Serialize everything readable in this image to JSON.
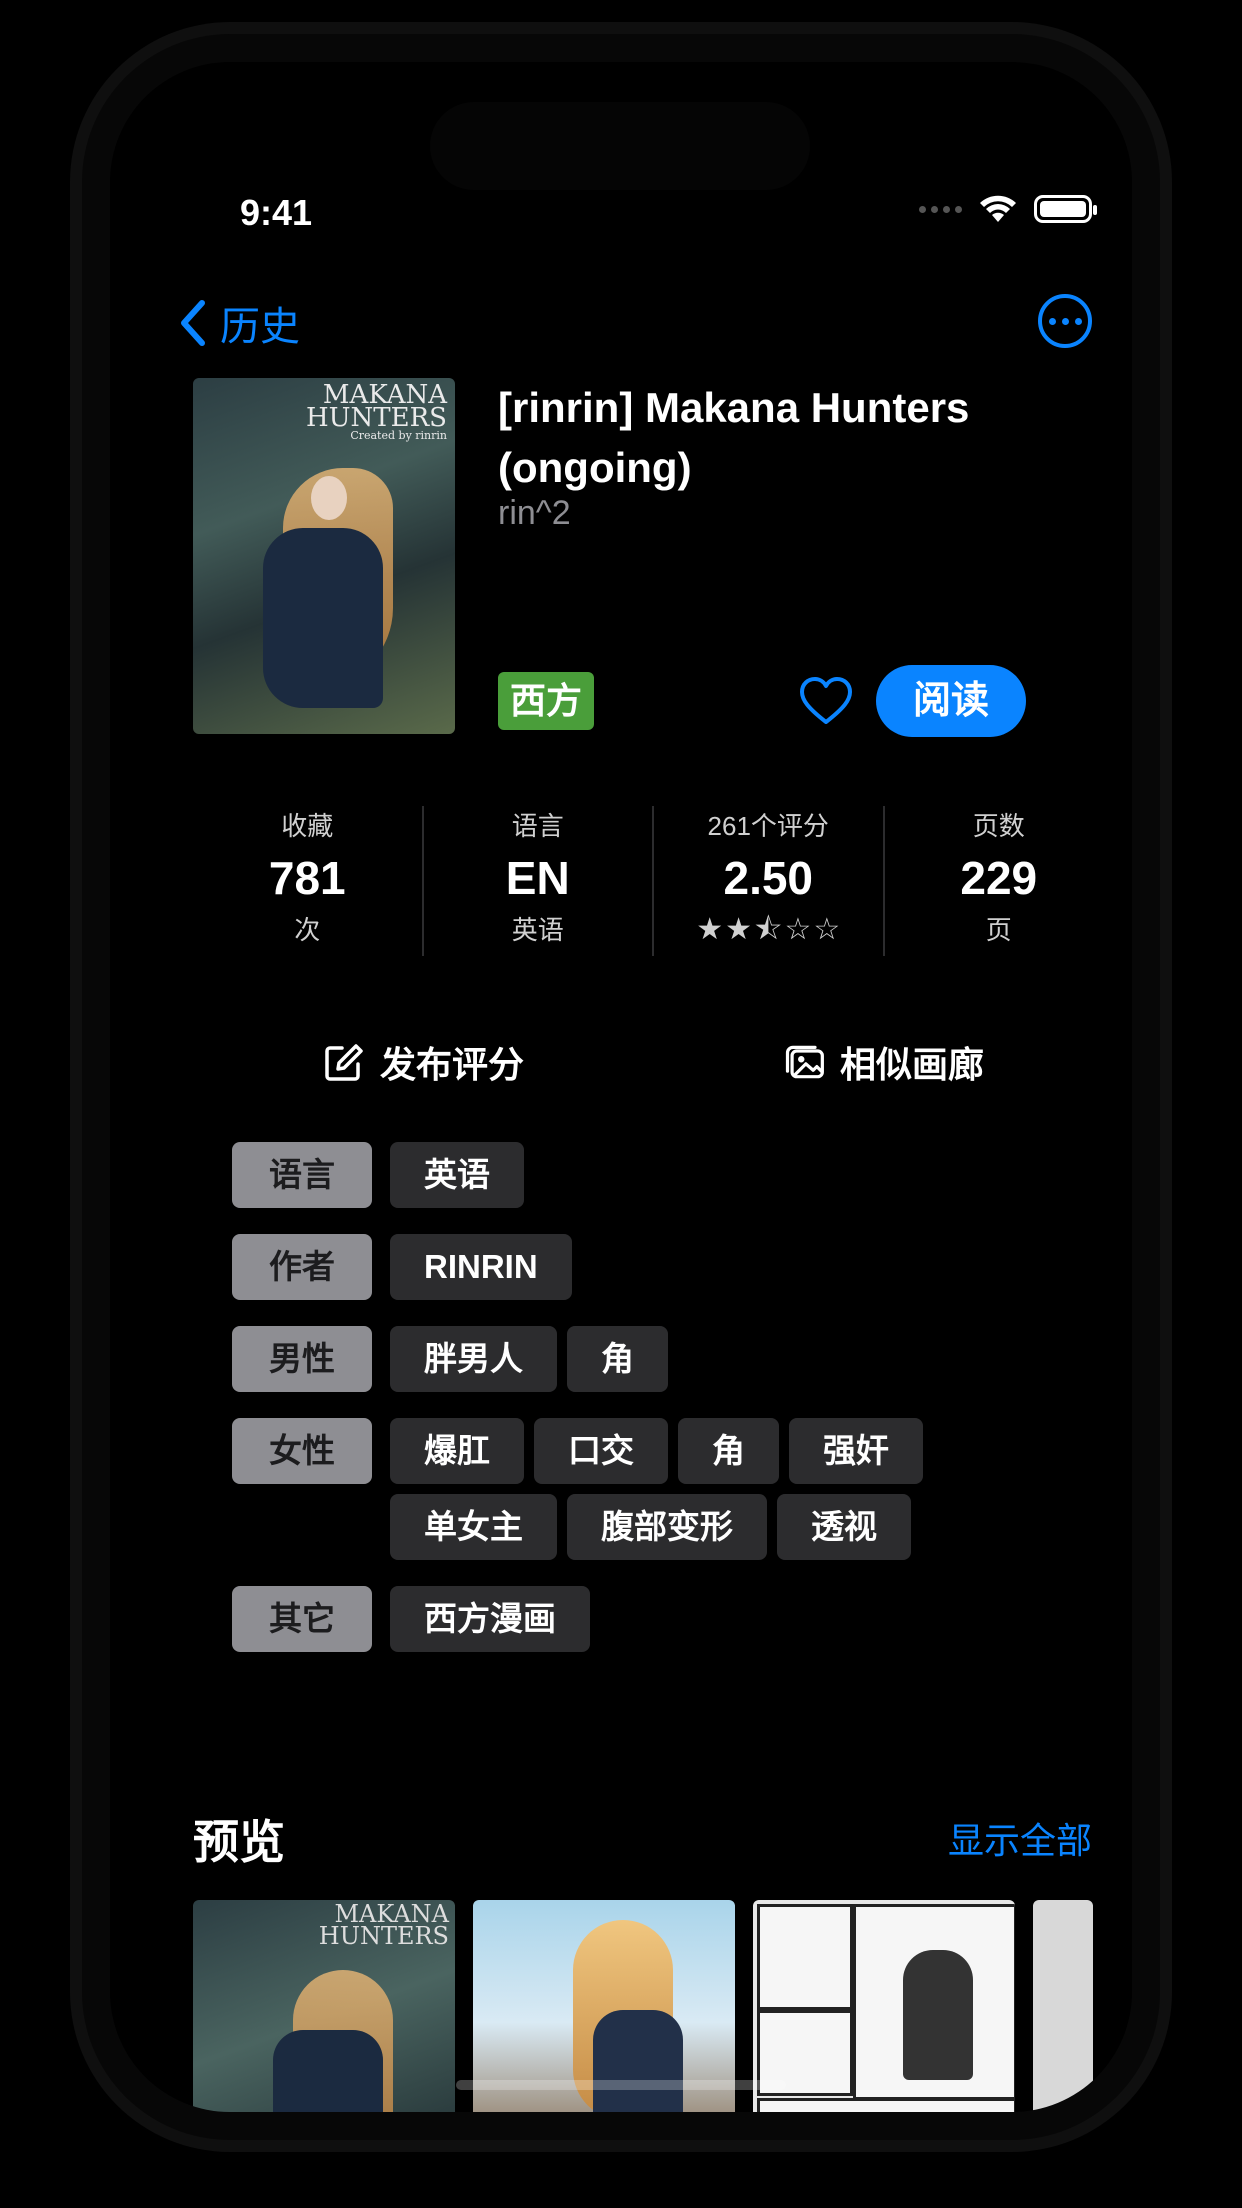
{
  "status_bar": {
    "time": "9:41"
  },
  "nav": {
    "back_label": "历史"
  },
  "gallery": {
    "title": "[rinrin] Makana Hunters (ongoing)",
    "artist": "rin^2",
    "category": "西方",
    "category_color": "#4a9e3a",
    "read_label": "阅读",
    "cover_logo_line1": "MAKANA",
    "cover_logo_line2": "HUNTERS",
    "cover_logo_line3": "Created by rinrin"
  },
  "stats": [
    {
      "top": "收藏",
      "value": "781",
      "bottom": "次"
    },
    {
      "top": "语言",
      "value": "EN",
      "bottom": "英语"
    },
    {
      "top": "261个评分",
      "value": "2.50",
      "rating": 2.5
    },
    {
      "top": "页数",
      "value": "229",
      "bottom": "页"
    }
  ],
  "actions": {
    "rate_label": "发布评分",
    "similar_label": "相似画廊"
  },
  "tags": [
    {
      "key": "语言",
      "values": [
        "英语"
      ]
    },
    {
      "key": "作者",
      "values": [
        "RINRIN"
      ]
    },
    {
      "key": "男性",
      "values": [
        "胖男人",
        "角"
      ]
    },
    {
      "key": "女性",
      "values": [
        "爆肛",
        "口交",
        "角",
        "强奸",
        "单女主",
        "腹部变形",
        "透视"
      ]
    },
    {
      "key": "其它",
      "values": [
        "西方漫画"
      ]
    }
  ],
  "preview": {
    "title": "预览",
    "show_all_label": "显示全部"
  },
  "colors": {
    "accent": "#0a84ff",
    "tag_key_bg": "#8e8e93",
    "tag_bg": "#2c2c2e"
  }
}
